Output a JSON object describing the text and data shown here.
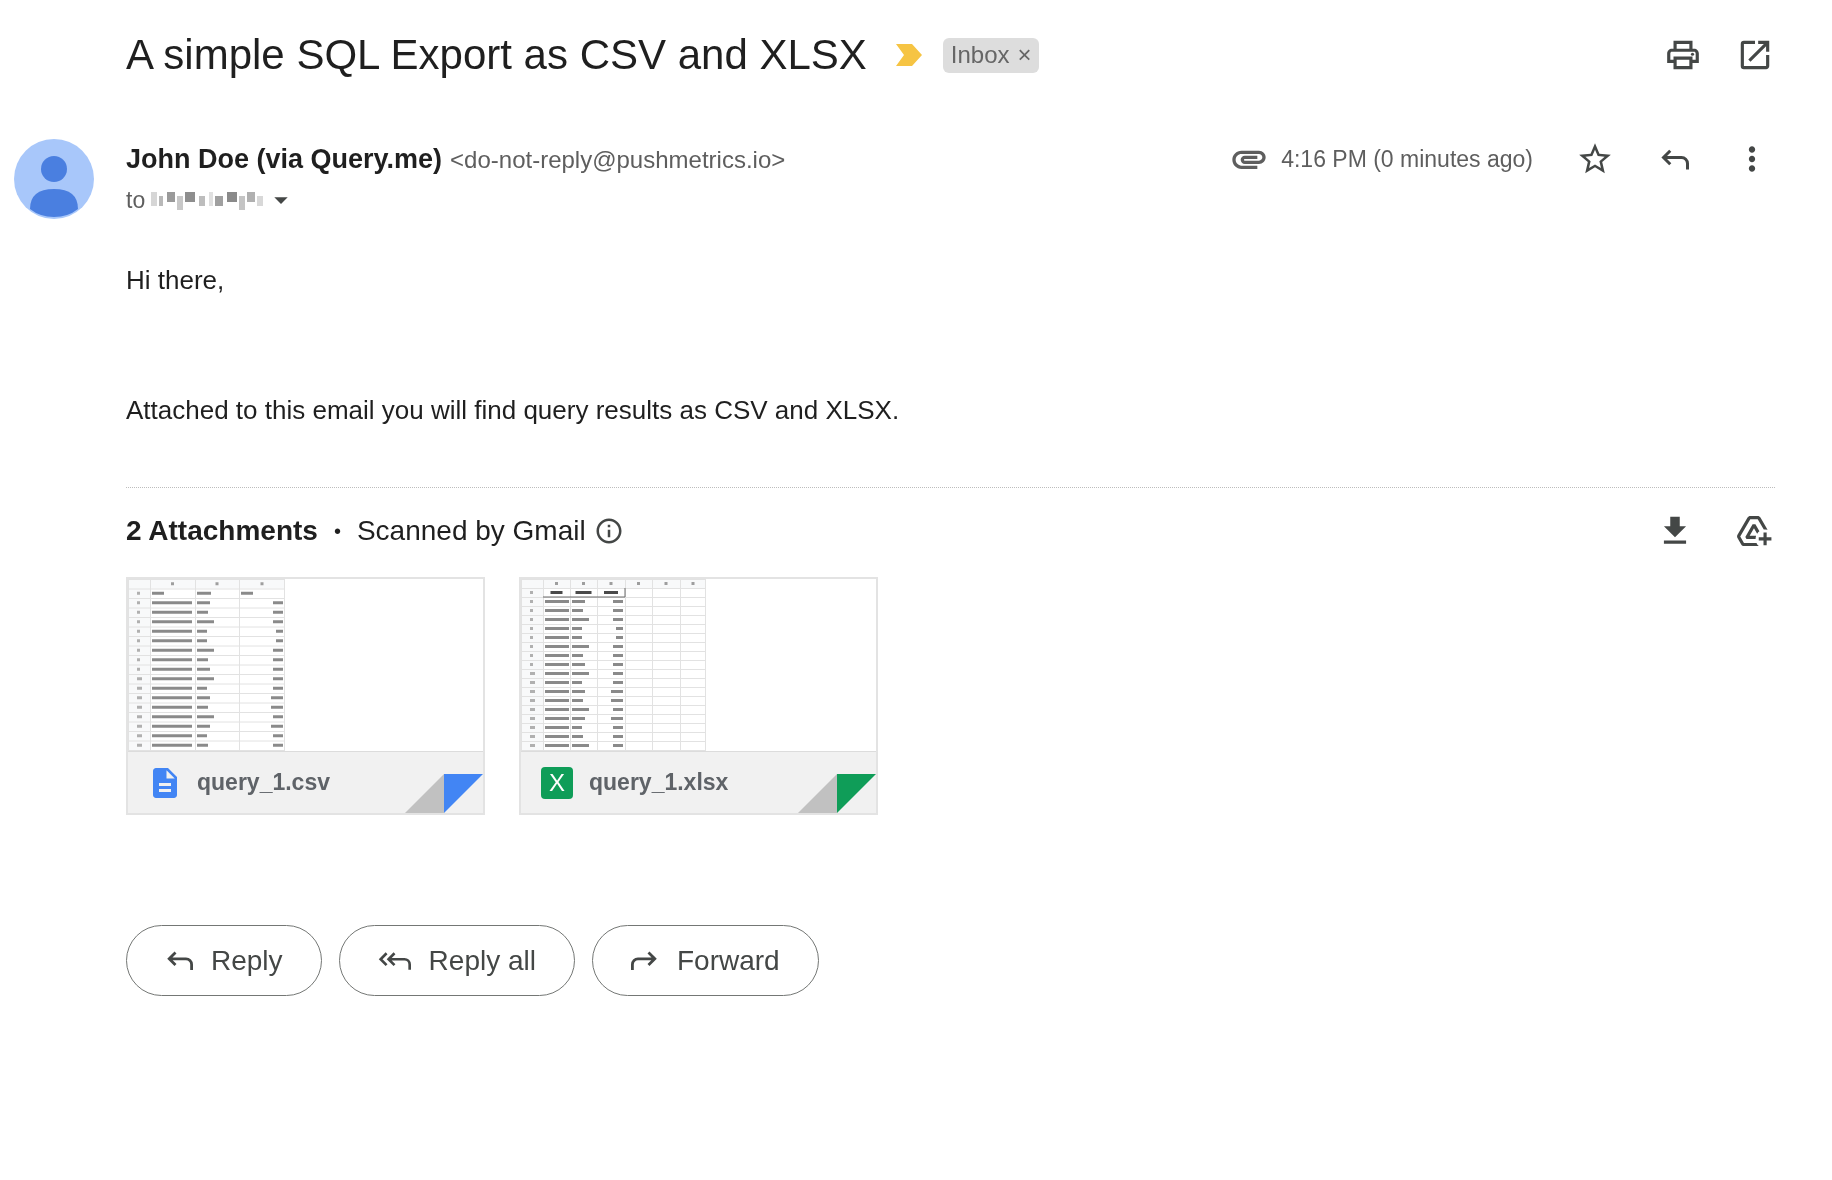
{
  "subject": {
    "title": "A simple SQL Export as CSV and XLSX",
    "important": true,
    "labels": [
      {
        "text": "Inbox",
        "remove": "×"
      }
    ]
  },
  "message": {
    "sender_name": "John Doe (via Query.me)",
    "sender_email": "<do-not-reply@pushmetrics.io>",
    "to_label": "to",
    "time": "4:16 PM (0 minutes ago)",
    "starred": false
  },
  "body": [
    "Hi there,",
    "Attached to this email you will find query results as CSV and XLSX."
  ],
  "attachments": {
    "title": "2 Attachments",
    "separator": "•",
    "scan_note": "Scanned by Gmail",
    "files": [
      {
        "name": "query_1.csv",
        "kind": "csv",
        "color": "#4285f4"
      },
      {
        "name": "query_1.xlsx",
        "kind": "xlsx",
        "badge": "X",
        "color": "#0f9d58"
      }
    ]
  },
  "actions": [
    {
      "label": "Reply",
      "kind": "reply"
    },
    {
      "label": "Reply all",
      "kind": "reply_all"
    },
    {
      "label": "Forward",
      "kind": "forward"
    }
  ]
}
